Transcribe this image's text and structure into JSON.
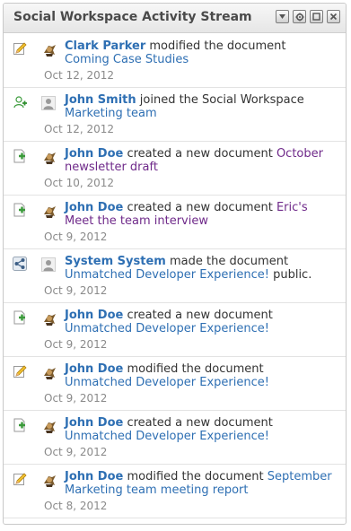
{
  "widget": {
    "title": "Social Workspace Activity Stream",
    "controls": [
      "menu-icon",
      "gear-icon",
      "maximize-icon",
      "close-icon"
    ]
  },
  "colors": {
    "link": "#2e6fb3",
    "visited_link": "#6f2a8a",
    "date": "#8a8a8a"
  },
  "entries": [
    {
      "type": "modified",
      "icon": "pencil-icon",
      "avatar": "user-photo",
      "user": "Clark Parker",
      "action": " modified the document ",
      "object": "Coming Case Studies",
      "suffix": "",
      "date": "Oct 12, 2012",
      "visited": false
    },
    {
      "type": "joined",
      "icon": "add-user-icon",
      "avatar": "default-avatar",
      "user": "John Smith",
      "action": " joined the Social Workspace ",
      "object": "Marketing team",
      "suffix": "",
      "date": "Oct 12, 2012",
      "visited": false
    },
    {
      "type": "created",
      "icon": "new-document-icon",
      "avatar": "user-photo",
      "user": "John Doe",
      "action": " created a new document ",
      "object": "October newsletter draft",
      "suffix": "",
      "date": "Oct 10, 2012",
      "visited": true
    },
    {
      "type": "created",
      "icon": "new-document-icon",
      "avatar": "user-photo",
      "user": "John Doe",
      "action": " created a new document ",
      "object": "Eric's Meet the team interview",
      "suffix": "",
      "date": "Oct 9, 2012",
      "visited": true
    },
    {
      "type": "published",
      "icon": "share-icon",
      "avatar": "default-avatar",
      "user": "System System",
      "action": " made the document ",
      "object": "Unmatched Developer Experience!",
      "suffix": " public.",
      "date": "Oct 9, 2012",
      "visited": false
    },
    {
      "type": "created",
      "icon": "new-document-icon",
      "avatar": "user-photo",
      "user": "John Doe",
      "action": " created a new document ",
      "object": "Unmatched Developer Experience!",
      "suffix": "",
      "date": "Oct 9, 2012",
      "visited": false
    },
    {
      "type": "modified",
      "icon": "pencil-icon",
      "avatar": "user-photo",
      "user": "John Doe",
      "action": " modified the document ",
      "object": "Unmatched Developer Experience!",
      "suffix": "",
      "date": "Oct 9, 2012",
      "visited": false
    },
    {
      "type": "created",
      "icon": "new-document-icon",
      "avatar": "user-photo",
      "user": "John Doe",
      "action": " created a new document ",
      "object": "Unmatched Developer Experience!",
      "suffix": "",
      "date": "Oct 9, 2012",
      "visited": false
    },
    {
      "type": "modified",
      "icon": "pencil-icon",
      "avatar": "user-photo",
      "user": "John Doe",
      "action": " modified the document ",
      "object": "September Marketing team meeting report",
      "suffix": "",
      "date": "Oct 8, 2012",
      "visited": false
    }
  ]
}
